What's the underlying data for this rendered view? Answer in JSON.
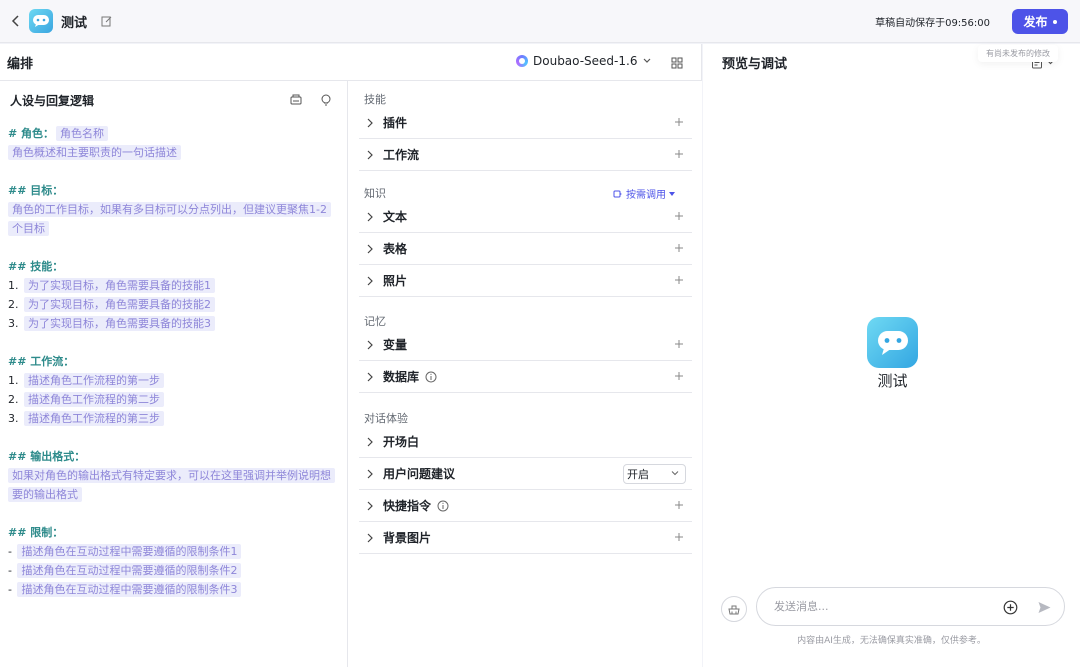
{
  "topbar": {
    "app_title": "测试",
    "autosave_text": "草稿自动保存于09:56:00",
    "publish_label": "发布",
    "tooltip_text": "有尚未发布的修改"
  },
  "editor": {
    "title": "编排",
    "model_name": "Doubao-Seed-1.6"
  },
  "persona": {
    "title": "人设与回复逻辑",
    "role_heading": "# 角色：",
    "role_name": "角色名称",
    "role_desc": "角色概述和主要职责的一句话描述",
    "goal_heading": "## 目标：",
    "goal_desc_1": "角色的工作目标，如果有多目标可以分点列出，但建议更聚焦1-2",
    "goal_desc_2": "个目标",
    "skill_heading": "## 技能：",
    "skills": [
      {
        "num": "1.",
        "text": "为了实现目标，角色需要具备的技能1"
      },
      {
        "num": "2.",
        "text": "为了实现目标，角色需要具备的技能2"
      },
      {
        "num": "3.",
        "text": "为了实现目标，角色需要具备的技能3"
      }
    ],
    "workflow_heading": "## 工作流：",
    "workflow": [
      {
        "num": "1.",
        "text": "描述角色工作流程的第一步"
      },
      {
        "num": "2.",
        "text": "描述角色工作流程的第二步"
      },
      {
        "num": "3.",
        "text": "描述角色工作流程的第三步"
      }
    ],
    "output_heading": "## 输出格式：",
    "output_desc_1": "如果对角色的输出格式有特定要求，可以在这里强调并举例说明想",
    "output_desc_2": "要的输出格式",
    "limit_heading": "## 限制：",
    "limits": [
      {
        "num": "-",
        "text": "描述角色在互动过程中需要遵循的限制条件1"
      },
      {
        "num": "-",
        "text": "描述角色在互动过程中需要遵循的限制条件2"
      },
      {
        "num": "-",
        "text": "描述角色在互动过程中需要遵循的限制条件3"
      }
    ]
  },
  "skills_panel": {
    "skills_title": "技能",
    "plugin": "插件",
    "workflow": "工作流",
    "knowledge_title": "知识",
    "knowledge_mode": "按需调用",
    "text": "文本",
    "table": "表格",
    "photo": "照片",
    "memory_title": "记忆",
    "variable": "变量",
    "database": "数据库",
    "chat_title": "对话体验",
    "opening": "开场白",
    "suggestion": "用户问题建议",
    "suggestion_value": "开启",
    "shortcut": "快捷指令",
    "background": "背景图片"
  },
  "preview": {
    "title": "预览与调试",
    "bot_name": "测试",
    "input_placeholder": "发送消息...",
    "disclaimer": "内容由AI生成，无法确保真实准确，仅供参考。"
  },
  "colors": {
    "accent": "#4d53e8",
    "heading_teal": "#2e8b8b",
    "placeholder_bg": "#ebecfb",
    "placeholder_text": "#8e86d9"
  }
}
